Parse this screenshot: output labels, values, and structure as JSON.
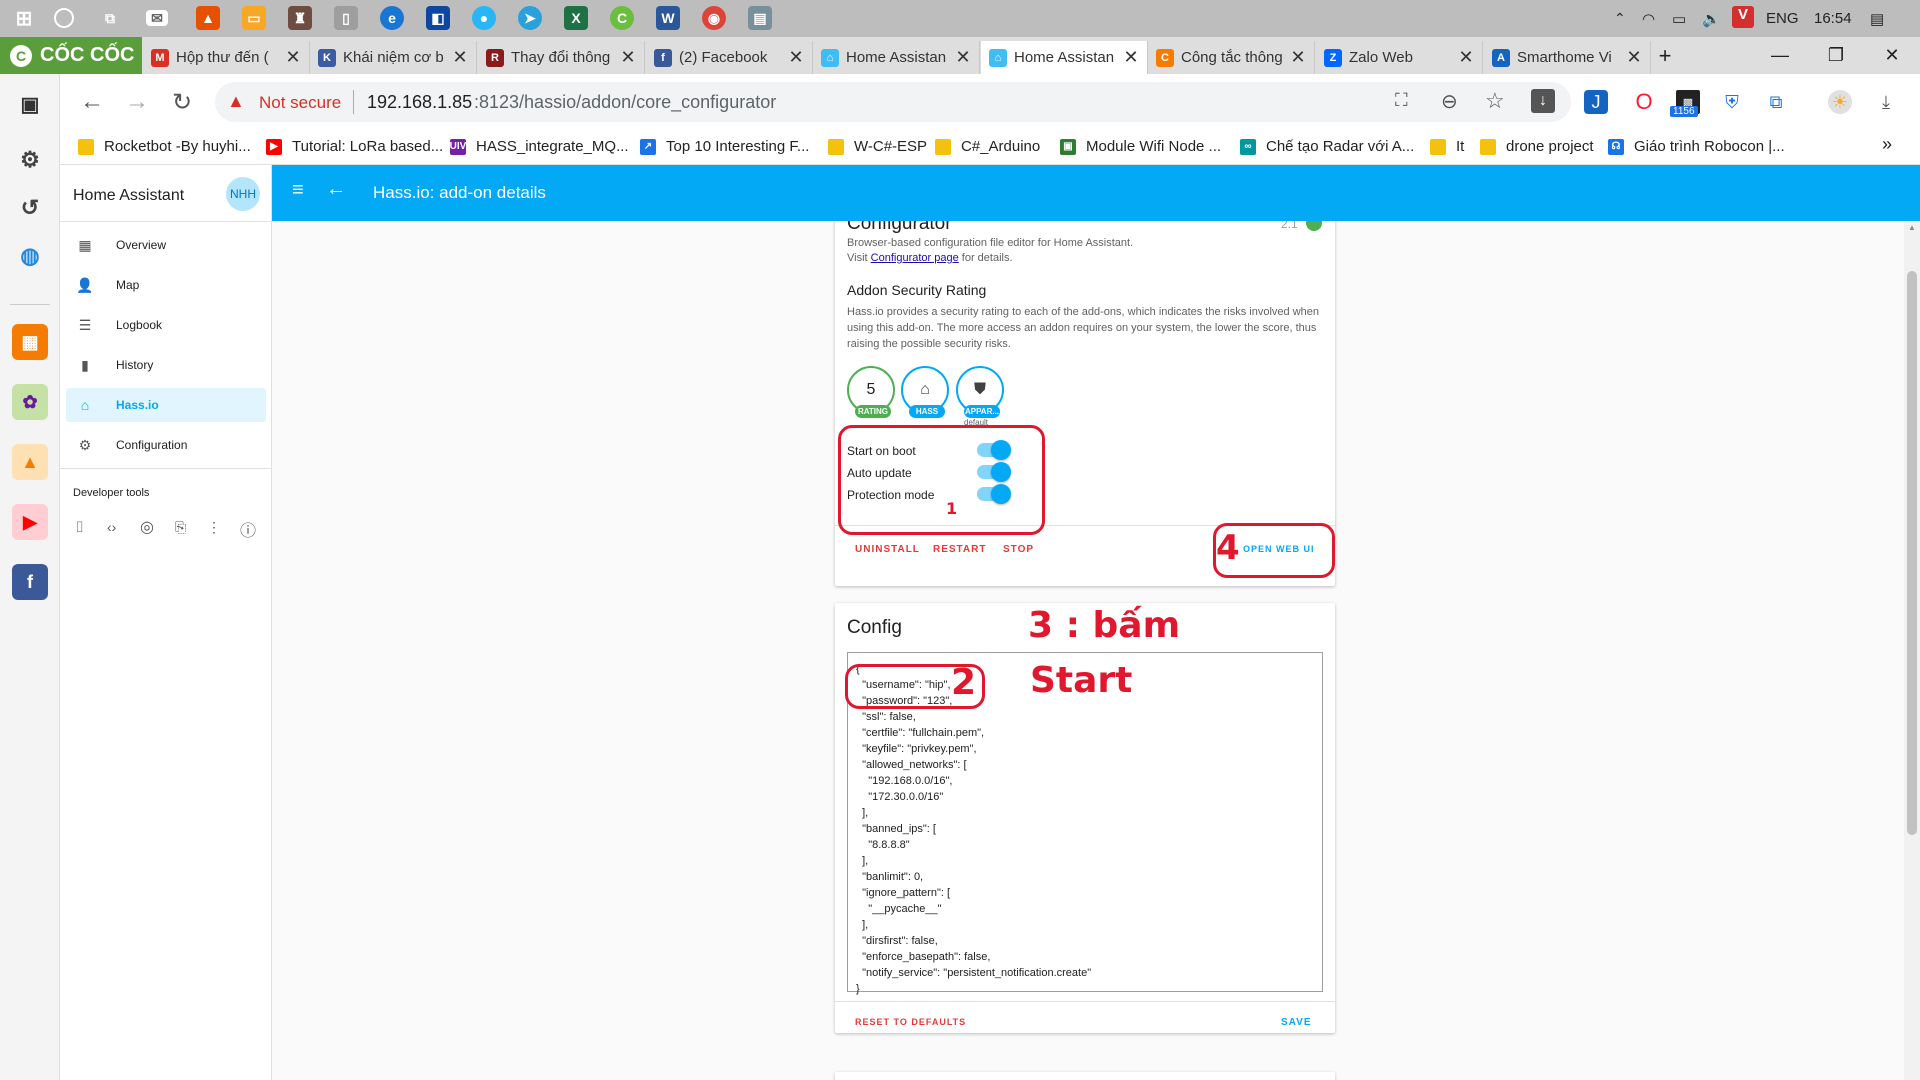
{
  "taskbar": {
    "time": "16:54",
    "language": "ENG"
  },
  "browser": {
    "brand": "CỐC CỐC",
    "tabs": [
      {
        "title": "Hộp thư đến (",
        "fav_color": "#d93025",
        "fav_glyph": "M"
      },
      {
        "title": "Khái niệm cơ b",
        "fav_color": "#3b5ba5",
        "fav_glyph": "K"
      },
      {
        "title": "Thay đổi thông",
        "fav_color": "#8b1a1a",
        "fav_glyph": "R"
      },
      {
        "title": "(2) Facebook",
        "fav_color": "#3b5998",
        "fav_glyph": "f"
      },
      {
        "title": "Home Assistan",
        "fav_color": "#41bdf5",
        "fav_glyph": "⌂"
      },
      {
        "title": "Home Assistan",
        "fav_color": "#41bdf5",
        "fav_glyph": "⌂",
        "active": true
      },
      {
        "title": "Công tắc thông",
        "fav_color": "#f57c00",
        "fav_glyph": "C"
      },
      {
        "title": "Zalo Web",
        "fav_color": "#0068ff",
        "fav_glyph": "Z"
      },
      {
        "title": "Smarthome Vi",
        "fav_color": "#1565c0",
        "fav_glyph": "A"
      }
    ],
    "security_label": "Not secure",
    "url_host": "192.168.1.85",
    "url_rest": ":8123/hassio/addon/core_configurator",
    "download_badge": "1156"
  },
  "bookmarks": [
    {
      "label": "Rocketbot -By huyhi...",
      "color": "#f4c20d",
      "glyph": ""
    },
    {
      "label": "Tutorial: LoRa based...",
      "color": "#ff0000",
      "glyph": "▶"
    },
    {
      "label": "HASS_integrate_MQ...",
      "color": "#7b1fa2",
      "glyph": "UIV"
    },
    {
      "label": "Top 10 Interesting F...",
      "color": "#1a73e8",
      "glyph": "↗"
    },
    {
      "label": "W-C#-ESP",
      "color": "#f4c20d",
      "glyph": ""
    },
    {
      "label": "C#_Arduino",
      "color": "#f4c20d",
      "glyph": ""
    },
    {
      "label": "Module Wifi Node ...",
      "color": "#2e7d32",
      "glyph": "▣"
    },
    {
      "label": "Chế tạo Radar với A...",
      "color": "#00979d",
      "glyph": "∞"
    },
    {
      "label": "It",
      "color": "#f4c20d",
      "glyph": ""
    },
    {
      "label": "drone project",
      "color": "#f4c20d",
      "glyph": ""
    },
    {
      "label": "Giáo trình Robocon |...",
      "color": "#1a73e8",
      "glyph": "☊"
    }
  ],
  "ha": {
    "app_title": "Home Assistant",
    "avatar": "NHH",
    "page_title": "Hass.io: add-on details",
    "nav": [
      {
        "label": "Overview",
        "icon": "▦"
      },
      {
        "label": "Map",
        "icon": "👤"
      },
      {
        "label": "Logbook",
        "icon": "☰"
      },
      {
        "label": "History",
        "icon": "▮"
      },
      {
        "label": "Hass.io",
        "icon": "⌂",
        "selected": true
      },
      {
        "label": "Configuration",
        "icon": "⚙"
      }
    ],
    "dev_tools_label": "Developer tools",
    "addon": {
      "name": "Configurator",
      "version": "2.1",
      "description": "Browser-based configuration file editor for Home Assistant.",
      "visit_prefix": "Visit",
      "visit_link": "Configurator page",
      "visit_suffix": "for details.",
      "security_heading": "Addon Security Rating",
      "security_text": "Hass.io provides a security rating to each of the add-ons, which indicates the risks involved when using this add-on. The more access an addon requires on your system, the lower the score, thus raising the possible security risks.",
      "rating_value": "5",
      "rating_label": "RATING",
      "hass_label": "HASS",
      "apparmor_label": "APPAR...",
      "apparmor_sub": "default",
      "toggles": [
        {
          "label": "Start on boot",
          "on": true
        },
        {
          "label": "Auto update",
          "on": true
        },
        {
          "label": "Protection mode",
          "on": true
        }
      ],
      "actions": {
        "uninstall": "UNINSTALL",
        "restart": "RESTART",
        "stop": "STOP",
        "open_web_ui": "OPEN WEB UI"
      }
    },
    "config": {
      "heading": "Config",
      "lines": [
        "{",
        "  \"username\": \"hip\",",
        "  \"password\": \"123\",",
        "  \"ssl\": false,",
        "  \"certfile\": \"fullchain.pem\",",
        "  \"keyfile\": \"privkey.pem\",",
        "  \"allowed_networks\": [",
        "    \"192.168.0.0/16\",",
        "    \"172.30.0.0/16\"",
        "  ],",
        "  \"banned_ips\": [",
        "    \"8.8.8.8\"",
        "  ],",
        "  \"banlimit\": 0,",
        "  \"ignore_pattern\": [",
        "    \"__pycache__\"",
        "  ],",
        "  \"dirsfirst\": false,",
        "  \"enforce_basepath\": false,",
        "  \"notify_service\": \"persistent_notification.create\"",
        "}"
      ],
      "reset": "RESET TO DEFAULTS",
      "save": "SAVE"
    }
  },
  "annotations": {
    "a1": "1",
    "a2": "2",
    "a3_line1": "3 : bấm",
    "a3_line2": "Start",
    "a4": "4"
  }
}
